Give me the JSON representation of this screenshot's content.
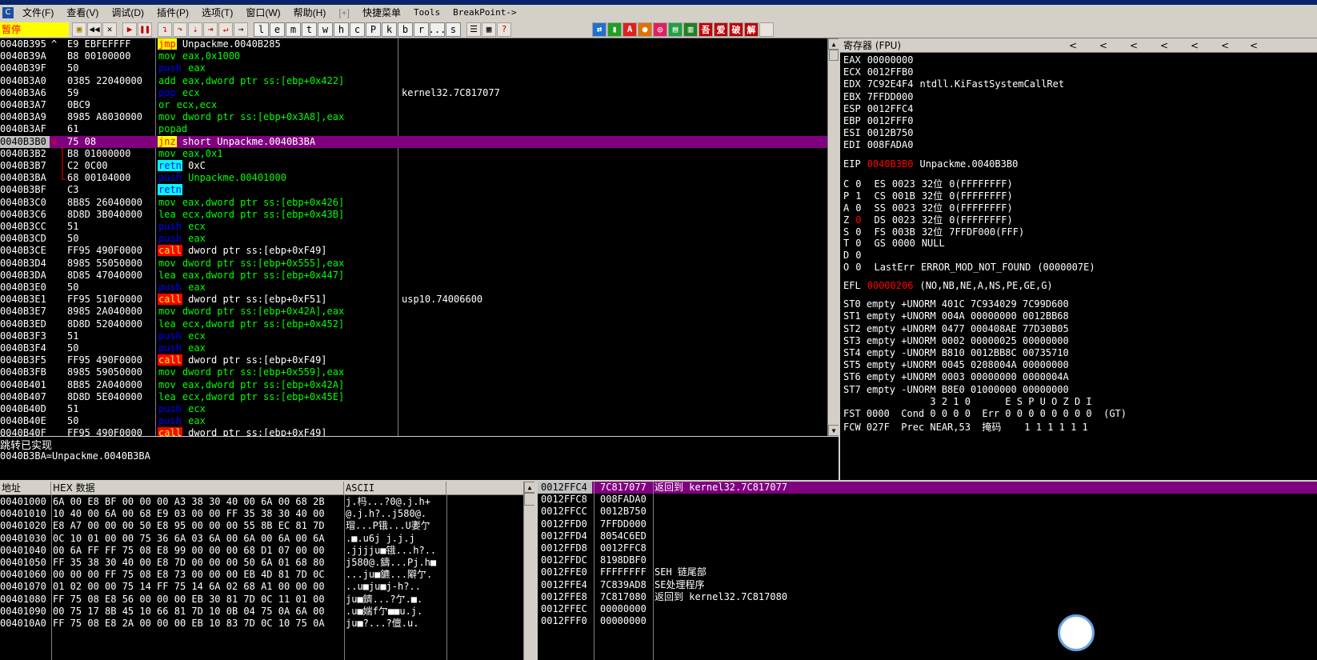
{
  "menu": {
    "app_icon": "C",
    "items": [
      "文件(F)",
      "查看(V)",
      "调试(D)",
      "插件(P)",
      "选项(T)",
      "窗口(W)",
      "帮助(H)",
      "[+]",
      "快捷菜单",
      "Tools",
      "BreakPoint->"
    ]
  },
  "toolbar": {
    "status": "暂停",
    "letters": [
      "l",
      "e",
      "m",
      "t",
      "w",
      "h",
      "c",
      "P",
      "k",
      "b",
      "r",
      "...",
      "s"
    ],
    "right_buttons": [
      "A",
      "吾",
      "爱",
      "破",
      "解"
    ]
  },
  "disasm": {
    "rows": [
      {
        "addr": "0040B395",
        "mark": "^",
        "hex": "E9 EBFEFFFF",
        "mn": "jmp",
        "mnk": "k-jmp",
        "ops": " Unpackme.0040B285",
        "cmt": ""
      },
      {
        "addr": "0040B39A",
        "mark": "",
        "hex": "B8 00100000",
        "mn": "mov",
        "mnk": "k-mov",
        "ops": " eax,0x1000",
        "cmt": ""
      },
      {
        "addr": "0040B39F",
        "mark": "",
        "hex": "50",
        "mn": "push",
        "mnk": "k-push",
        "ops": " eax",
        "cmt": ""
      },
      {
        "addr": "0040B3A0",
        "mark": "",
        "hex": "0385 22040000",
        "mn": "add",
        "mnk": "k-mov",
        "ops": " eax,dword ptr ss:[ebp+0x422]",
        "cmt": ""
      },
      {
        "addr": "0040B3A6",
        "mark": "",
        "hex": "59",
        "mn": "pop",
        "mnk": "k-pop",
        "ops": " ecx",
        "cmt": "kernel32.7C817077"
      },
      {
        "addr": "0040B3A7",
        "mark": "",
        "hex": "0BC9",
        "mn": "or",
        "mnk": "k-mov",
        "ops": " ecx,ecx",
        "cmt": ""
      },
      {
        "addr": "0040B3A9",
        "mark": "",
        "hex": "8985 A8030000",
        "mn": "mov",
        "mnk": "k-mov",
        "ops": " dword ptr ss:[ebp+0x3A8],eax",
        "cmt": ""
      },
      {
        "addr": "0040B3AF",
        "mark": "",
        "hex": "61",
        "mn": "popad",
        "mnk": "k-mov",
        "ops": "",
        "cmt": ""
      },
      {
        "addr": "0040B3B0",
        "mark": "v",
        "hex": "75 08",
        "mn": "jnz",
        "mnk": "k-jnz",
        "ops": " short Unpackme.0040B3BA",
        "cmt": "",
        "sel": true
      },
      {
        "addr": "0040B3B2",
        "mark": "",
        "hex": "B8 01000000",
        "mn": "mov",
        "mnk": "k-mov",
        "ops": " eax,0x1",
        "cmt": ""
      },
      {
        "addr": "0040B3B7",
        "mark": "",
        "hex": "C2 0C00",
        "mn": "retn",
        "mnk": "k-retn",
        "ops": " 0xC",
        "cmt": ""
      },
      {
        "addr": "0040B3BA",
        "mark": "",
        "hex": "68 00104000",
        "mn": "push",
        "mnk": "k-push",
        "ops": " Unpackme.00401000",
        "cmt": ""
      },
      {
        "addr": "0040B3BF",
        "mark": "",
        "hex": "C3",
        "mn": "retn",
        "mnk": "k-retn",
        "ops": "",
        "cmt": ""
      },
      {
        "addr": "0040B3C0",
        "mark": "",
        "hex": "8B85 26040000",
        "mn": "mov",
        "mnk": "k-mov",
        "ops": " eax,dword ptr ss:[ebp+0x426]",
        "cmt": ""
      },
      {
        "addr": "0040B3C6",
        "mark": "",
        "hex": "8D8D 3B040000",
        "mn": "lea",
        "mnk": "k-mov",
        "ops": " ecx,dword ptr ss:[ebp+0x43B]",
        "cmt": ""
      },
      {
        "addr": "0040B3CC",
        "mark": "",
        "hex": "51",
        "mn": "push",
        "mnk": "k-push",
        "ops": " ecx",
        "cmt": ""
      },
      {
        "addr": "0040B3CD",
        "mark": "",
        "hex": "50",
        "mn": "push",
        "mnk": "k-push",
        "ops": " eax",
        "cmt": ""
      },
      {
        "addr": "0040B3CE",
        "mark": "",
        "hex": "FF95 490F0000",
        "mn": "call",
        "mnk": "k-call",
        "ops": " dword ptr ss:[ebp+0xF49]",
        "cmt": ""
      },
      {
        "addr": "0040B3D4",
        "mark": "",
        "hex": "8985 55050000",
        "mn": "mov",
        "mnk": "k-mov",
        "ops": " dword ptr ss:[ebp+0x555],eax",
        "cmt": ""
      },
      {
        "addr": "0040B3DA",
        "mark": "",
        "hex": "8D85 47040000",
        "mn": "lea",
        "mnk": "k-mov",
        "ops": " eax,dword ptr ss:[ebp+0x447]",
        "cmt": ""
      },
      {
        "addr": "0040B3E0",
        "mark": "",
        "hex": "50",
        "mn": "push",
        "mnk": "k-push",
        "ops": " eax",
        "cmt": ""
      },
      {
        "addr": "0040B3E1",
        "mark": "",
        "hex": "FF95 510F0000",
        "mn": "call",
        "mnk": "k-call",
        "ops": " dword ptr ss:[ebp+0xF51]",
        "cmt": "usp10.74006600"
      },
      {
        "addr": "0040B3E7",
        "mark": "",
        "hex": "8985 2A040000",
        "mn": "mov",
        "mnk": "k-mov",
        "ops": " dword ptr ss:[ebp+0x42A],eax",
        "cmt": ""
      },
      {
        "addr": "0040B3ED",
        "mark": "",
        "hex": "8D8D 52040000",
        "mn": "lea",
        "mnk": "k-mov",
        "ops": " ecx,dword ptr ss:[ebp+0x452]",
        "cmt": ""
      },
      {
        "addr": "0040B3F3",
        "mark": "",
        "hex": "51",
        "mn": "push",
        "mnk": "k-push",
        "ops": " ecx",
        "cmt": ""
      },
      {
        "addr": "0040B3F4",
        "mark": "",
        "hex": "50",
        "mn": "push",
        "mnk": "k-push",
        "ops": " eax",
        "cmt": ""
      },
      {
        "addr": "0040B3F5",
        "mark": "",
        "hex": "FF95 490F0000",
        "mn": "call",
        "mnk": "k-call",
        "ops": " dword ptr ss:[ebp+0xF49]",
        "cmt": ""
      },
      {
        "addr": "0040B3FB",
        "mark": "",
        "hex": "8985 59050000",
        "mn": "mov",
        "mnk": "k-mov",
        "ops": " dword ptr ss:[ebp+0x559],eax",
        "cmt": ""
      },
      {
        "addr": "0040B401",
        "mark": "",
        "hex": "8B85 2A040000",
        "mn": "mov",
        "mnk": "k-mov",
        "ops": " eax,dword ptr ss:[ebp+0x42A]",
        "cmt": ""
      },
      {
        "addr": "0040B407",
        "mark": "",
        "hex": "8D8D 5E040000",
        "mn": "lea",
        "mnk": "k-mov",
        "ops": " ecx,dword ptr ss:[ebp+0x45E]",
        "cmt": ""
      },
      {
        "addr": "0040B40D",
        "mark": "",
        "hex": "51",
        "mn": "push",
        "mnk": "k-push",
        "ops": " ecx",
        "cmt": ""
      },
      {
        "addr": "0040B40E",
        "mark": "",
        "hex": "50",
        "mn": "push",
        "mnk": "k-push",
        "ops": " eax",
        "cmt": ""
      },
      {
        "addr": "0040B40F",
        "mark": "",
        "hex": "FF95 490F0000",
        "mn": "call",
        "mnk": "k-call",
        "ops": " dword ptr ss:[ebp+0xF49]",
        "cmt": ""
      }
    ]
  },
  "info": {
    "line1": "跳转已实现",
    "line2": "0040B3BA=Unpackme.0040B3BA"
  },
  "registers": {
    "title": "寄存器 (FPU)",
    "gp": [
      {
        "name": "EAX",
        "val": "00000000",
        "extra": ""
      },
      {
        "name": "ECX",
        "val": "0012FFB0",
        "extra": ""
      },
      {
        "name": "EDX",
        "val": "7C92E4F4",
        "extra": "ntdll.KiFastSystemCallRet"
      },
      {
        "name": "EBX",
        "val": "7FFDD000",
        "extra": ""
      },
      {
        "name": "ESP",
        "val": "0012FFC4",
        "extra": ""
      },
      {
        "name": "EBP",
        "val": "0012FFF0",
        "extra": ""
      },
      {
        "name": "ESI",
        "val": "0012B750",
        "extra": ""
      },
      {
        "name": "EDI",
        "val": "008FADA0",
        "extra": ""
      }
    ],
    "eip": {
      "name": "EIP",
      "val": "0040B3B0",
      "extra": "Unpackme.0040B3B0"
    },
    "flags": [
      {
        "f": "C",
        "v": "0",
        "seg": "ES",
        "sel": "0023",
        "bits": "32位",
        "rest": "0(FFFFFFFF)"
      },
      {
        "f": "P",
        "v": "1",
        "seg": "CS",
        "sel": "001B",
        "bits": "32位",
        "rest": "0(FFFFFFFF)"
      },
      {
        "f": "A",
        "v": "0",
        "seg": "SS",
        "sel": "0023",
        "bits": "32位",
        "rest": "0(FFFFFFFF)"
      },
      {
        "f": "Z",
        "v": "0",
        "seg": "DS",
        "sel": "0023",
        "bits": "32位",
        "rest": "0(FFFFFFFF)",
        "red": true
      },
      {
        "f": "S",
        "v": "0",
        "seg": "FS",
        "sel": "003B",
        "bits": "32位",
        "rest": "7FFDF000(FFF)"
      },
      {
        "f": "T",
        "v": "0",
        "seg": "GS",
        "sel": "0000",
        "bits": "NULL",
        "rest": ""
      },
      {
        "f": "D",
        "v": "0",
        "seg": "",
        "sel": "",
        "bits": "",
        "rest": ""
      },
      {
        "f": "O",
        "v": "0",
        "seg": "LastErr",
        "sel": "ERROR_MOD_NOT_FOUND",
        "bits": "(0000007E)",
        "rest": ""
      }
    ],
    "efl": {
      "name": "EFL",
      "val": "00000206",
      "extra": "(NO,NB,NE,A,NS,PE,GE,G)"
    },
    "st": [
      "ST0 empty +UNORM 401C 7C934029 7C99D600",
      "ST1 empty +UNORM 004A 00000000 0012BB68",
      "ST2 empty +UNORM 0477 000408AE 77D30B05",
      "ST3 empty +UNORM 0002 00000025 00000000",
      "ST4 empty -UNORM B810 0012BB8C 00735710",
      "ST5 empty +UNORM 0045 0208004A 00000000",
      "ST6 empty +UNORM 0003 00000000 0000004A",
      "ST7 empty -UNORM B8E0 01000000 00000000"
    ],
    "fpu_hdr": "               3 2 1 0      E S P U O Z D I",
    "fst": "FST 0000  Cond 0 0 0 0  Err 0 0 0 0 0 0 0 0  (GT)",
    "fcw": "FCW 027F  Prec NEAR,53  掩码    1 1 1 1 1 1"
  },
  "dump": {
    "headers": {
      "addr": "地址",
      "hex": "HEX 数据",
      "ascii": "ASCII"
    },
    "rows": [
      {
        "a": "00401000",
        "h": "6A 00 E8 BF 00 00 00 A3 38 30 40 00 6A 00 68 2B",
        "c": "j.杩...?0@.j.h+"
      },
      {
        "a": "00401010",
        "h": "10 40 00 6A 00 68 E9 03 00 00 FF 35 38 30 40 00",
        "c": "@.j.h?..j580@."
      },
      {
        "a": "00401020",
        "h": "E8 A7 00 00 00 50 E8 95 00 00 00 55 8B EC 81 7D",
        "c": "瑁...P锇...U嬱亇"
      },
      {
        "a": "00401030",
        "h": "0C 10 01 00 00 75 36 6A 03 6A 00 6A 00 6A 00 6A",
        "c": ".■.u6j j.j.j"
      },
      {
        "a": "00401040",
        "h": "00 6A FF FF 75 08 E8 99 00 00 00 68 D1 07 00 00",
        "c": ".jjjju■锇...h?.."
      },
      {
        "a": "00401050",
        "h": "FF 35 38 30 40 00 E8 7D 00 00 00 50 6A 01 68 80",
        "c": "j580@.鑄...Pj.h■"
      },
      {
        "a": "00401060",
        "h": "00 00 00 FF 75 08 E8 73 00 00 00 EB 4D 81 7D 0C",
        "c": "...ju■鑣...隦亇."
      },
      {
        "a": "00401070",
        "h": "01 02 00 00 75 14 FF 75 14 6A 02 68 A1 00 00 00",
        "c": "..u■ju■j-h?.."
      },
      {
        "a": "00401080",
        "h": "FF 75 08 E8 56 00 00 00 EB 30 81 7D 0C 11 01 00",
        "c": "ju■鑇...?亇.■."
      },
      {
        "a": "00401090",
        "h": "00 75 17 8B 45 10 66 81 7D 10 0B 04 75 0A 6A 00",
        "c": ".u■媏f亇■■u.j."
      },
      {
        "a": "004010A0",
        "h": "FF 75 08 E8 2A 00 00 00 EB 10 83 7D 0C 10 75 0A",
        "c": "ju■?...?儃.u."
      }
    ]
  },
  "stack": {
    "rows": [
      {
        "a": "0012FFC4",
        "v": "7C817077",
        "c": "返回到 kernel32.7C817077",
        "sel": true
      },
      {
        "a": "0012FFC8",
        "v": "008FADA0",
        "c": ""
      },
      {
        "a": "0012FFCC",
        "v": "0012B750",
        "c": ""
      },
      {
        "a": "0012FFD0",
        "v": "7FFDD000",
        "c": ""
      },
      {
        "a": "0012FFD4",
        "v": "8054C6ED",
        "c": ""
      },
      {
        "a": "0012FFD8",
        "v": "0012FFC8",
        "c": ""
      },
      {
        "a": "0012FFDC",
        "v": "8198DBF0",
        "c": ""
      },
      {
        "a": "0012FFE0",
        "v": "FFFFFFFF",
        "c": "SEH 链尾部"
      },
      {
        "a": "0012FFE4",
        "v": "7C839AD8",
        "c": "SE处理程序"
      },
      {
        "a": "0012FFE8",
        "v": "7C817080",
        "c": "返回到 kernel32.7C817080"
      },
      {
        "a": "0012FFEC",
        "v": "00000000",
        "c": ""
      },
      {
        "a": "0012FFF0",
        "v": "00000000",
        "c": ""
      }
    ]
  },
  "colors": {
    "selection": "#800080",
    "background": "#000000",
    "chrome": "#d4d0c8"
  }
}
